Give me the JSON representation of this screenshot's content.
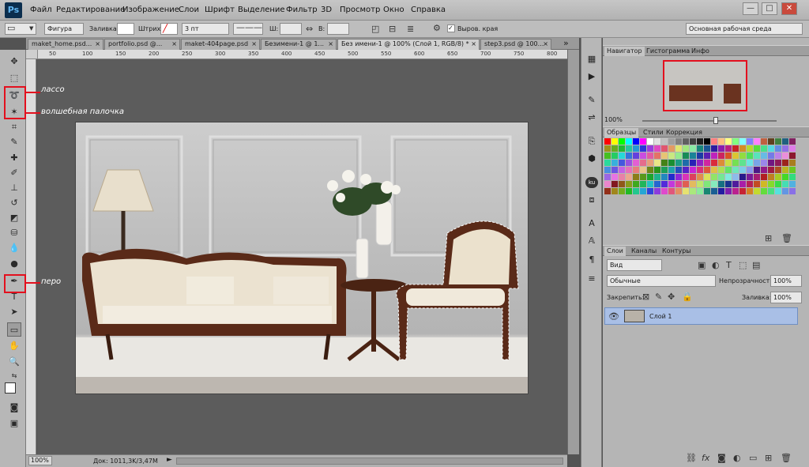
{
  "app": {
    "logo": "Ps"
  },
  "menu": [
    "Файл",
    "Редактирование",
    "Изображение",
    "Слои",
    "Шрифт",
    "Выделение",
    "Фильтр",
    "3D",
    "Просмотр",
    "Окно",
    "Справка"
  ],
  "window_buttons": {
    "minimize": "—",
    "restore": "□",
    "close": "✕"
  },
  "options": {
    "mode": "Фигура",
    "fill_label": "Заливка:",
    "stroke_label": "Штрих:",
    "stroke_width": "3 пт",
    "w_label": "Ш:",
    "h_label": "В:",
    "align_edges": "Выров. края",
    "workspace": "Основная рабочая среда"
  },
  "doc_tabs": [
    "maket_home.psd...",
    "portfolio.psd @...",
    "maket-404page.psd",
    "Безимени-1 @ 1...",
    "Без имени-1 @ 100% (Слой 1, RGB/8) *",
    "step3.psd @ 100..."
  ],
  "doc_tab_close": "×",
  "ruler": [
    "50",
    "100",
    "150",
    "200",
    "250",
    "300",
    "350",
    "400",
    "450",
    "500",
    "550",
    "600",
    "650",
    "700",
    "750",
    "800"
  ],
  "status": {
    "zoom": "100%",
    "doc": "Док: 1011,3K/3,47M"
  },
  "annotations": {
    "lasso": "лассо",
    "magic_wand": "волшебная палочка",
    "pen": "перо"
  },
  "navigator": {
    "tabs": [
      "Навигатор",
      "Гистограмма",
      "Инфо"
    ],
    "zoom": "100%"
  },
  "swatches": {
    "tabs": [
      "Образцы",
      "Стили",
      "Коррекция"
    ]
  },
  "layers": {
    "tabs": [
      "Слои",
      "Каналы",
      "Контуры"
    ],
    "kind": "Вид",
    "blend": "Обычные",
    "opacity_label": "Непрозрачность:",
    "opacity": "100%",
    "lock_label": "Закрепить:",
    "fill_label": "Заливка:",
    "fill": "100%",
    "items": [
      {
        "name": "Слой 1"
      }
    ]
  },
  "colors": {
    "annotation": "#e3101e",
    "selected_layer": "#a9bfe6"
  }
}
